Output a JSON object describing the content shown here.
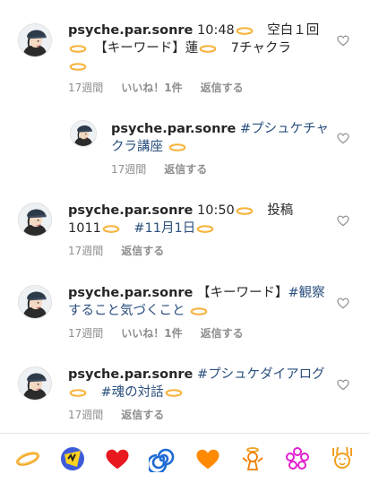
{
  "comments": [
    {
      "username": "psyche.par.sonre",
      "parts": [
        " 10:48",
        "　空白１回",
        "【キーワード】蓮",
        "　7チャクラ"
      ],
      "time": "17週間",
      "likes": "いいね！1件",
      "reply": "返信する"
    },
    {
      "username": "psyche.par.sonre",
      "tag1": " #プシュケチャ",
      "tag2": "クラ講座",
      "time": "17週間",
      "reply": "返信する"
    },
    {
      "username": "psyche.par.sonre",
      "parts": [
        " 10:50",
        "　投稿",
        "1011",
        "　"
      ],
      "tag": "#11月1日",
      "time": "17週間",
      "reply": "返信する"
    },
    {
      "username": "psyche.par.sonre",
      "text": " 【キーワード】",
      "tag1": "#観察",
      "tag2": "すること気づくこと",
      "time": "17週間",
      "likes": "いいね！1件",
      "reply": "返信する"
    },
    {
      "username": "psyche.par.sonre",
      "tag1": " #プシュケダイアログ",
      "tag2": "#魂の対話",
      "time": "17週間",
      "reply": "返信する"
    }
  ],
  "emoji_bar": [
    "halo-ring-icon",
    "ghost-wink-icon",
    "red-heart-icon",
    "cyclone-icon",
    "orange-heart-icon",
    "angel-icon",
    "flower-icon",
    "raised-hands-icon"
  ],
  "colors": {
    "hashtag": "#2a4f7e",
    "meta": "#8e8e8e",
    "halo": "#f0a020"
  }
}
